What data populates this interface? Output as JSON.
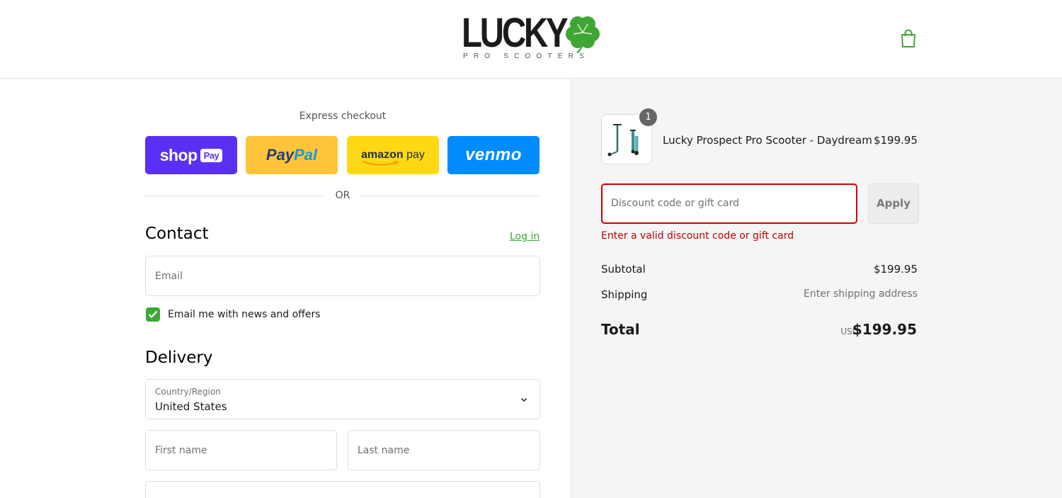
{
  "header": {
    "logo_word": "LUCKY",
    "logo_sub": "PRO SCOOTERS",
    "cart_icon": "shopping-bag-icon"
  },
  "express": {
    "title": "Express checkout",
    "buttons": {
      "shop": "shop",
      "shop_pay": "Pay",
      "paypal_a": "Pay",
      "paypal_b": "Pal",
      "amazon_a": "amazon",
      "amazon_b": " pay",
      "venmo": "venmo"
    },
    "separator": "OR"
  },
  "contact": {
    "title": "Contact",
    "login": "Log in",
    "email_placeholder": "Email",
    "newsletter_label": "Email me with news and offers",
    "newsletter_checked": true
  },
  "delivery": {
    "title": "Delivery",
    "country_label": "Country/Region",
    "country_value": "United States",
    "first_name_placeholder": "First name",
    "last_name_placeholder": "Last name",
    "address_placeholder": ""
  },
  "summary": {
    "product": {
      "name": "Lucky Prospect Pro Scooter - Daydream",
      "price": "$199.95",
      "quantity": "1"
    },
    "discount_placeholder": "Discount code or gift card",
    "apply_label": "Apply",
    "error": "Enter a valid discount code or gift card",
    "subtotal_label": "Subtotal",
    "subtotal_value": "$199.95",
    "shipping_label": "Shipping",
    "shipping_value": "Enter shipping address",
    "total_label": "Total",
    "total_currency": "USD",
    "total_value": "$199.95"
  },
  "colors": {
    "accent_green": "#3fa634",
    "error_red": "#c00000",
    "shop_purple": "#5a31f4",
    "paypal_yellow": "#ffc439",
    "amazon_yellow": "#ffd814",
    "venmo_blue": "#008cff"
  }
}
